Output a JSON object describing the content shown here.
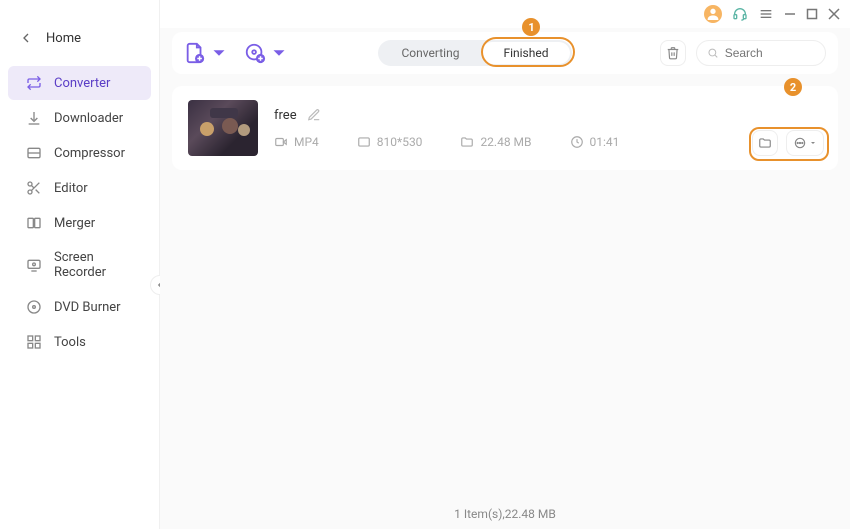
{
  "window": {
    "home_label": "Home"
  },
  "sidebar": {
    "items": [
      {
        "label": "Converter"
      },
      {
        "label": "Downloader"
      },
      {
        "label": "Compressor"
      },
      {
        "label": "Editor"
      },
      {
        "label": "Merger"
      },
      {
        "label": "Screen Recorder"
      },
      {
        "label": "DVD Burner"
      },
      {
        "label": "Tools"
      }
    ]
  },
  "toolbar": {
    "seg_converting": "Converting",
    "seg_finished": "Finished"
  },
  "search": {
    "placeholder": "Search"
  },
  "callouts": {
    "one": "1",
    "two": "2"
  },
  "file": {
    "title": "free",
    "format": "MP4",
    "resolution": "810*530",
    "size": "22.48 MB",
    "duration": "01:41"
  },
  "status": {
    "summary": "1 Item(s),22.48 MB"
  }
}
